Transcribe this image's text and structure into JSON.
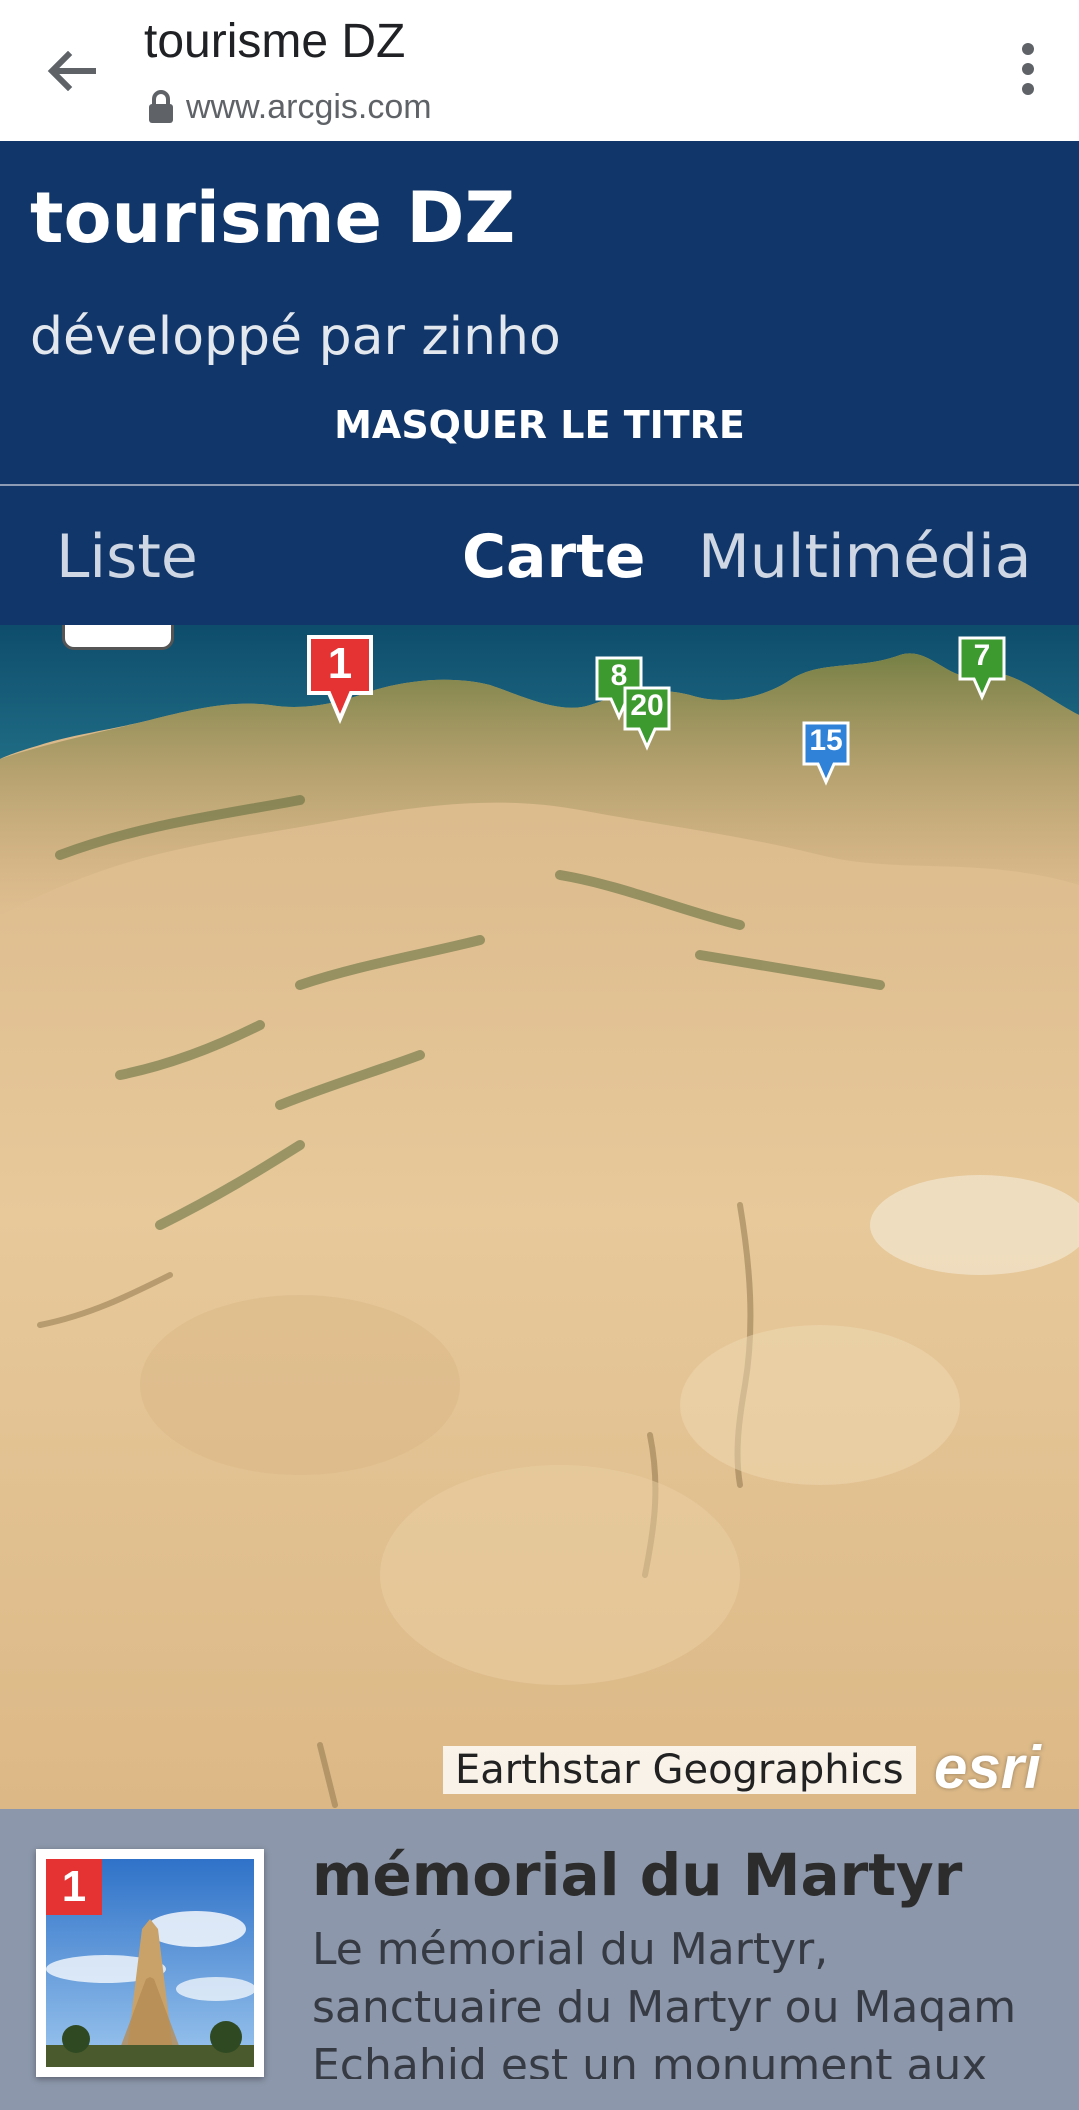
{
  "browser": {
    "page_title": "tourisme DZ",
    "url": "www.arcgis.com",
    "icons": {
      "back": "arrow-back-icon",
      "lock": "lock-icon",
      "menu": "more-vert-icon"
    }
  },
  "header": {
    "title": "tourisme DZ",
    "subtitle": "développé par zinho",
    "hide_title_label": "MASQUER LE TITRE"
  },
  "tabs": [
    {
      "label": "Liste",
      "active": false
    },
    {
      "label": "Carte",
      "active": true
    },
    {
      "label": "Multimédia",
      "active": false
    }
  ],
  "map": {
    "markers": [
      {
        "label": "1",
        "color": "#e53232"
      },
      {
        "label": "8",
        "color": "#3d9a2f"
      },
      {
        "label": "20",
        "color": "#3d9a2f"
      },
      {
        "label": "7",
        "color": "#3d9a2f"
      },
      {
        "label": "15",
        "color": "#2f82d8"
      }
    ],
    "attribution": "Earthstar Geographics",
    "logo": "esri"
  },
  "selected_item": {
    "badge": "1",
    "title": "mémorial du Martyr",
    "description": "Le mémorial du Martyr, sanctuaire du Martyr ou Maqam Echahid est un monument aux morts"
  },
  "colors": {
    "header_bg": "#11366a",
    "panel_bg": "#8c97ab",
    "marker_red": "#e53232",
    "marker_green": "#3d9a2f",
    "marker_blue": "#2f82d8"
  }
}
